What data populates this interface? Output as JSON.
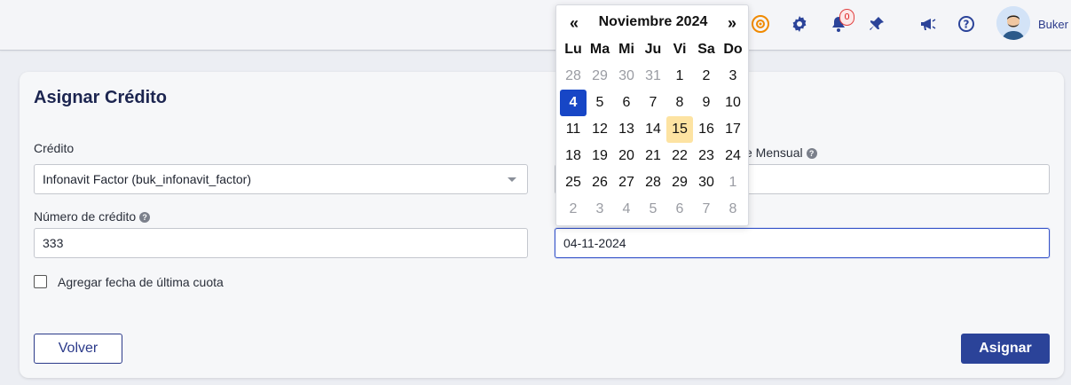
{
  "topbar": {
    "notifications_count": "0",
    "user_name": "Buker",
    "icons": [
      "broadcast-icon",
      "gear-icon",
      "bell-icon",
      "pin-icon",
      "megaphone-icon",
      "help-icon"
    ]
  },
  "card": {
    "title": "Asignar Crédito",
    "credito_label": "Crédito",
    "credito_value": "Infonavit Factor (buk_infonavit_factor)",
    "numero_label": "Número de crédito",
    "numero_value": "333",
    "monto_label_partial": "e Mensual",
    "fecha_value": "04-11-2024",
    "checkbox_label": "Agregar fecha de última cuota",
    "back_label": "Volver",
    "submit_label": "Asignar"
  },
  "datepicker": {
    "prev": "«",
    "next": "»",
    "title": "Noviembre 2024",
    "weekdays": [
      "Lu",
      "Ma",
      "Mi",
      "Ju",
      "Vi",
      "Sa",
      "Do"
    ],
    "weeks": [
      [
        "28",
        "29",
        "30",
        "31",
        "1",
        "2",
        "3"
      ],
      [
        "4",
        "5",
        "6",
        "7",
        "8",
        "9",
        "10"
      ],
      [
        "11",
        "12",
        "13",
        "14",
        "15",
        "16",
        "17"
      ],
      [
        "18",
        "19",
        "20",
        "21",
        "22",
        "23",
        "24"
      ],
      [
        "25",
        "26",
        "27",
        "28",
        "29",
        "30",
        "1"
      ],
      [
        "2",
        "3",
        "4",
        "5",
        "6",
        "7",
        "8"
      ]
    ],
    "selected_day": "4",
    "today_day": "15"
  },
  "colors": {
    "primary": "#2b4399",
    "selected": "#1746c6",
    "today": "#fde3a2",
    "badge": "#e14040"
  }
}
